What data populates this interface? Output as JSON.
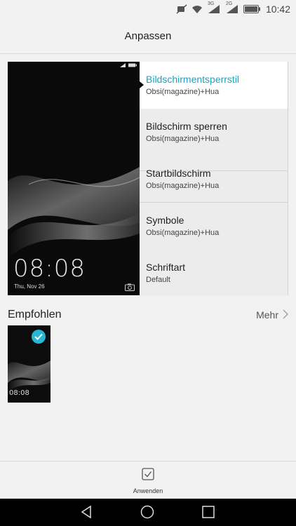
{
  "status_bar": {
    "time": "10:42",
    "net1": "3G",
    "net2": "2G"
  },
  "header": {
    "title": "Anpassen"
  },
  "preview": {
    "clock": "08:08",
    "date": "Thu, Nov 26"
  },
  "menu": {
    "items": [
      {
        "label": "Bildschirmentsperrstil",
        "sub": "Obsi(magazine)+Hua",
        "active": true
      },
      {
        "label": "Bildschirm sperren",
        "sub": "Obsi(magazine)+Hua"
      },
      {
        "label": "Startbildschirm",
        "sub": "Obsi(magazine)+Hua"
      },
      {
        "label": "Symbole",
        "sub": "Obsi(magazine)+Hua"
      },
      {
        "label": "Schriftart",
        "sub": "Default"
      }
    ]
  },
  "recommended": {
    "title": "Empfohlen",
    "more": "Mehr",
    "thumb_clock": "08:08"
  },
  "footer": {
    "apply": "Anwenden"
  },
  "colors": {
    "accent": "#1aa3c2",
    "check": "#29b6d2"
  }
}
